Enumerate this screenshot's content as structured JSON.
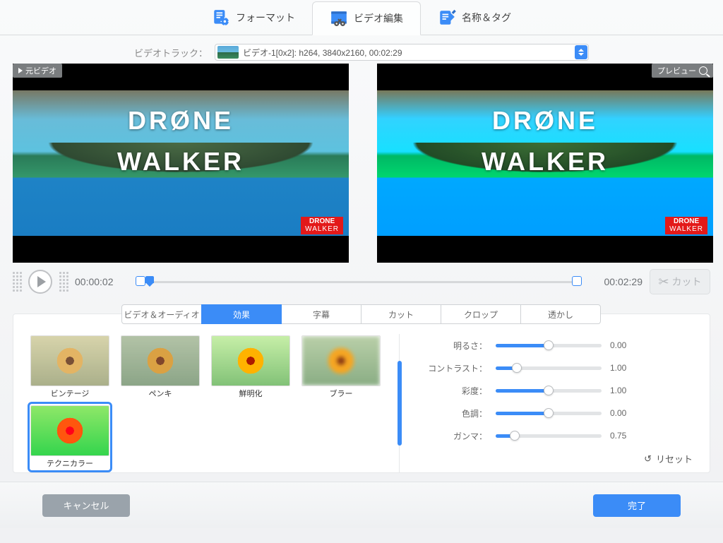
{
  "top_tabs": {
    "format": {
      "label": "フォーマット"
    },
    "edit": {
      "label": "ビデオ編集"
    },
    "tag": {
      "label": "名称＆タグ"
    }
  },
  "track": {
    "label": "ビデオトラック：",
    "selected": "ビデオ-1[0x2]: h264, 3840x2160, 00:02:29"
  },
  "preview": {
    "source_tag": "元ビデオ",
    "preview_tag": "プレビュー",
    "overlay_line1": "DRØNE",
    "overlay_line2": "WALKER",
    "watermark_top": "DRONE",
    "watermark_bottom": "WALKER"
  },
  "timeline": {
    "current": "00:00:02",
    "duration": "00:02:29",
    "cut_label": "カット"
  },
  "sub_tabs": [
    "ビデオ＆オーディオ",
    "効果",
    "字幕",
    "カット",
    "クロップ",
    "透かし"
  ],
  "effects": {
    "vintage": "ビンテージ",
    "paint": "ペンキ",
    "sharp": "鮮明化",
    "blur": "ブラー",
    "techni": "テクニカラー"
  },
  "sliders": {
    "brightness": {
      "label": "明るさ：",
      "value": "0.00",
      "pct": 50
    },
    "contrast": {
      "label": "コントラスト：",
      "value": "1.00",
      "pct": 20
    },
    "saturation": {
      "label": "彩度：",
      "value": "1.00",
      "pct": 50
    },
    "hue": {
      "label": "色調：",
      "value": "0.00",
      "pct": 50
    },
    "gamma": {
      "label": "ガンマ：",
      "value": "0.75",
      "pct": 18
    }
  },
  "reset_label": "リセット",
  "footer": {
    "cancel": "キャンセル",
    "done": "完了"
  }
}
